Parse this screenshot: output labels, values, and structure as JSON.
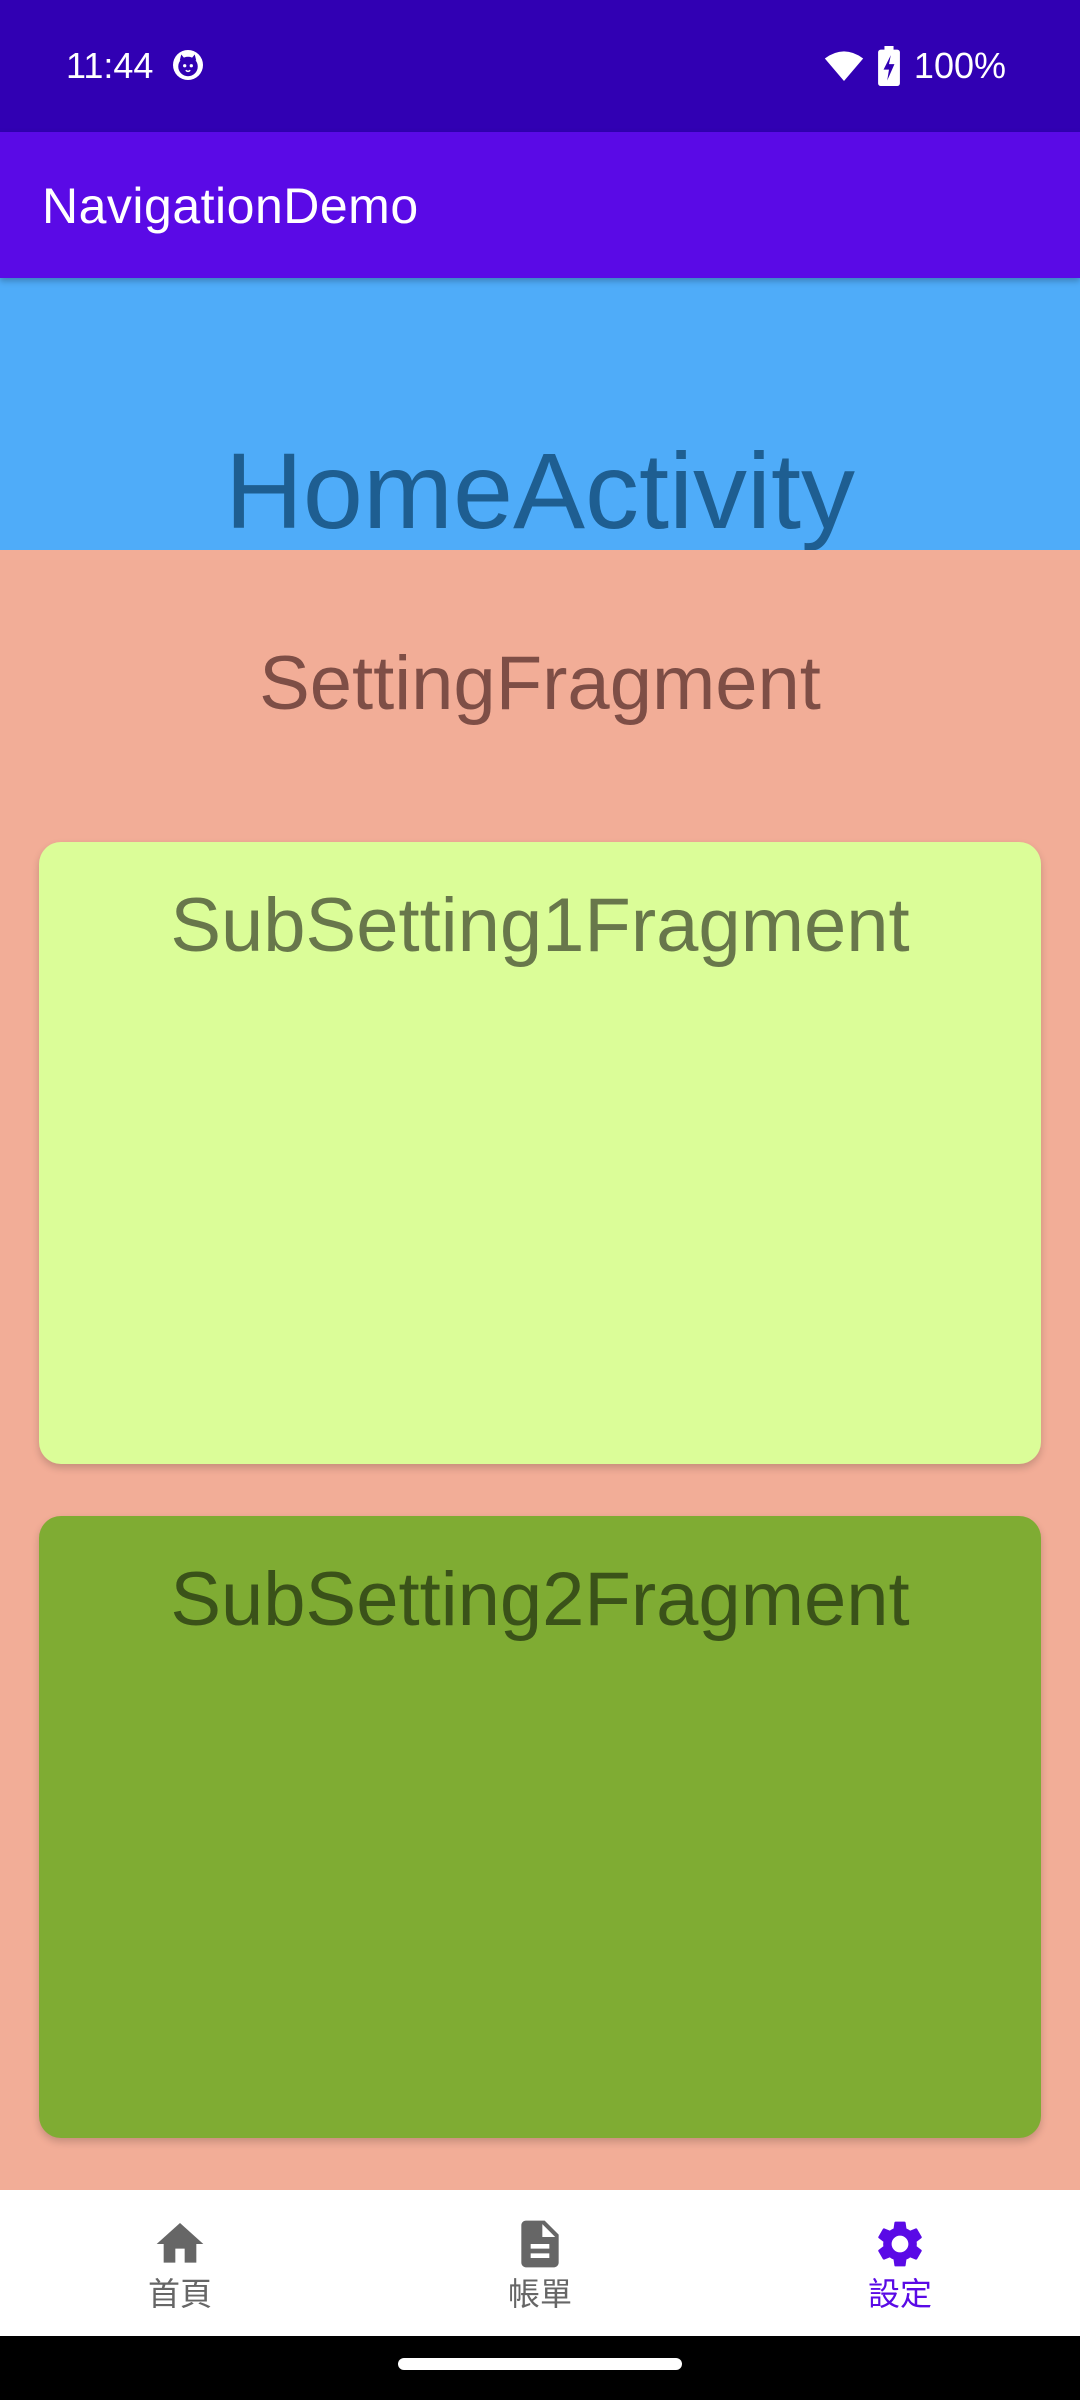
{
  "status_bar": {
    "time": "11:44",
    "battery_percent": "100%",
    "icons": [
      "cat-icon",
      "wifi-icon",
      "battery-charging-icon"
    ]
  },
  "app_bar": {
    "title": "NavigationDemo"
  },
  "activity": {
    "label": "HomeActivity"
  },
  "setting": {
    "label": "SettingFragment"
  },
  "sub_setting_1": {
    "label": "SubSetting1Fragment"
  },
  "sub_setting_2": {
    "label": "SubSetting2Fragment"
  },
  "bottom_nav": {
    "items": [
      {
        "label": "首頁",
        "icon": "home-icon",
        "active": false
      },
      {
        "label": "帳單",
        "icon": "document-icon",
        "active": false
      },
      {
        "label": "設定",
        "icon": "gear-icon",
        "active": true
      }
    ]
  },
  "colors": {
    "status_bar": "#3100b3",
    "app_bar": "#5a0ae6",
    "activity_bg": "#4facf9",
    "setting_bg": "#f2ad97",
    "sub_setting_1_bg": "#dbfd98",
    "sub_setting_2_bg": "#7fac33",
    "nav_active": "#5a0ae6",
    "nav_inactive": "#666666"
  }
}
